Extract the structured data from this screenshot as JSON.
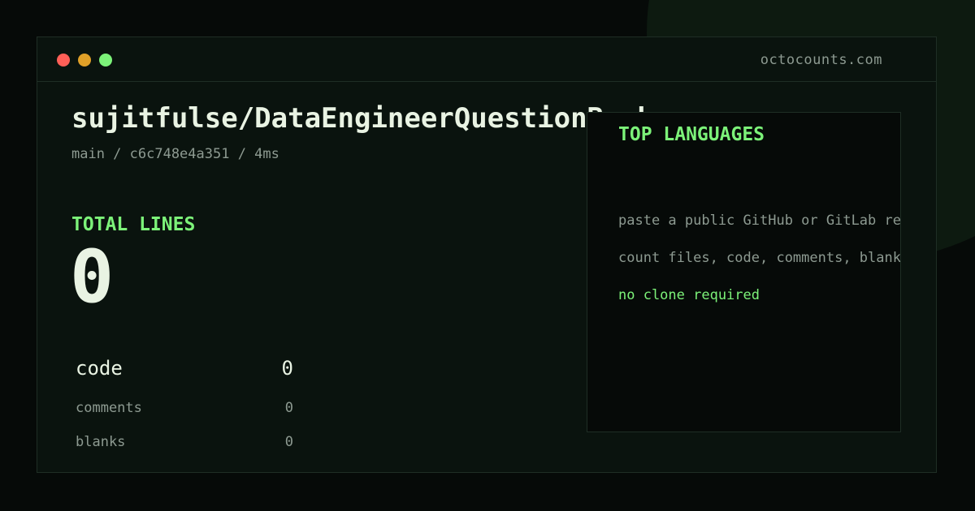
{
  "window": {
    "controls": {
      "close_color": "#ff5f57",
      "minimize_color": "#e0a028",
      "maximize_color": "#7cf279"
    },
    "site": "octocounts.com"
  },
  "repo": {
    "name": "sujitfulse/DataEngineerQuestionBank",
    "meta": "main / c6c748e4a351 / 4ms"
  },
  "totals": {
    "label": "TOTAL LINES",
    "value": "0"
  },
  "stats": [
    {
      "label": "code",
      "value": "0"
    },
    {
      "label": "comments",
      "value": "0"
    },
    {
      "label": "blanks",
      "value": "0"
    }
  ],
  "languages": {
    "title": "TOP LANGUAGES",
    "hints": [
      "paste a public GitHub or GitLab repo",
      "count files, code, comments, blanks",
      "no clone required"
    ]
  },
  "colors": {
    "background": "#060a08",
    "window": "#0a130e",
    "accent": "#7cf279",
    "text": "#e9f3e3",
    "muted": "#8d9a91"
  }
}
